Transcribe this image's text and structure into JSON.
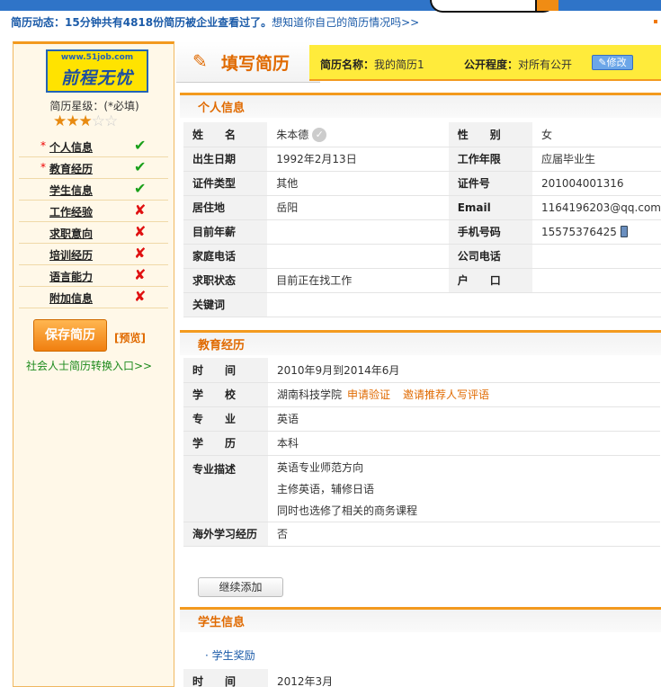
{
  "notice": {
    "label": "简历动态：",
    "highlight": "15分钟共有4818份简历被企业查看过了。",
    "link": "想知道你自己的简历情况吗>>"
  },
  "sidebar": {
    "logo_url": "www.51job.com",
    "logo_name": "前程无忧",
    "star_label": "简历星级：(*必填)",
    "stars_on": "★★★",
    "stars_off": "☆☆",
    "rating": 3,
    "rating_max": 5,
    "items": [
      {
        "label": "个人信息",
        "required": "*",
        "status": "✔"
      },
      {
        "label": "教育经历",
        "required": "*",
        "status": "✔"
      },
      {
        "label": "学生信息",
        "required": "",
        "status": "✔"
      },
      {
        "label": "工作经验",
        "required": "",
        "status": "✘"
      },
      {
        "label": "求职意向",
        "required": "",
        "status": "✘"
      },
      {
        "label": "培训经历",
        "required": "",
        "status": "✘"
      },
      {
        "label": "语言能力",
        "required": "",
        "status": "✘"
      },
      {
        "label": "附加信息",
        "required": "",
        "status": "✘"
      }
    ],
    "save_label": "保存简历",
    "preview_label": "[预览]",
    "switch_link": "社会人士简历转换入口>>"
  },
  "header": {
    "title": "填写简历",
    "resume_name_label": "简历名称：",
    "resume_name": "我的简历1",
    "public_label": "公开程度：",
    "public_value": "对所有公开",
    "edit_label": "修改"
  },
  "personal": {
    "title": "个人信息",
    "name_k": "姓　　名",
    "name_v": "朱本德",
    "gender_k": "性　　别",
    "gender_v": "女",
    "birth_k": "出生日期",
    "birth_v": "1992年2月13日",
    "years_k": "工作年限",
    "years_v": "应届毕业生",
    "idtype_k": "证件类型",
    "idtype_v": "其他",
    "idno_k": "证件号",
    "idno_v": "201004001316",
    "home_k": "居住地",
    "home_v": "岳阳",
    "email_k": "Email",
    "email_v": "1164196203@qq.com",
    "salary_k": "目前年薪",
    "salary_v": "",
    "mobile_k": "手机号码",
    "mobile_v": "15575376425",
    "hometel_k": "家庭电话",
    "hometel_v": "",
    "worktel_k": "公司电话",
    "worktel_v": "",
    "jobstatus_k": "求职状态",
    "jobstatus_v": "目前正在找工作",
    "hukou_k": "户　　口",
    "hukou_v": "",
    "keywords_k": "关键词",
    "keywords_v": ""
  },
  "education": {
    "title": "教育经历",
    "time_k": "时　　间",
    "time_v": "2010年9月到2014年6月",
    "school_k": "学　　校",
    "school_v": "湖南科技学院",
    "verify_link": "申请验证",
    "recommend_link": "邀请推荐人写评语",
    "major_k": "专　　业",
    "major_v": "英语",
    "degree_k": "学　　历",
    "degree_v": "本科",
    "desc_k": "专业描述",
    "desc_lines": [
      "英语专业师范方向",
      "主修英语，辅修日语",
      "同时也选修了相关的商务课程"
    ],
    "abroad_k": "海外学习经历",
    "abroad_v": "否",
    "continue_label": "继续添加"
  },
  "student": {
    "title": "学生信息",
    "awards_link": "· 学生奖励",
    "time_k": "时　　间",
    "time_v": "2012年3月"
  }
}
